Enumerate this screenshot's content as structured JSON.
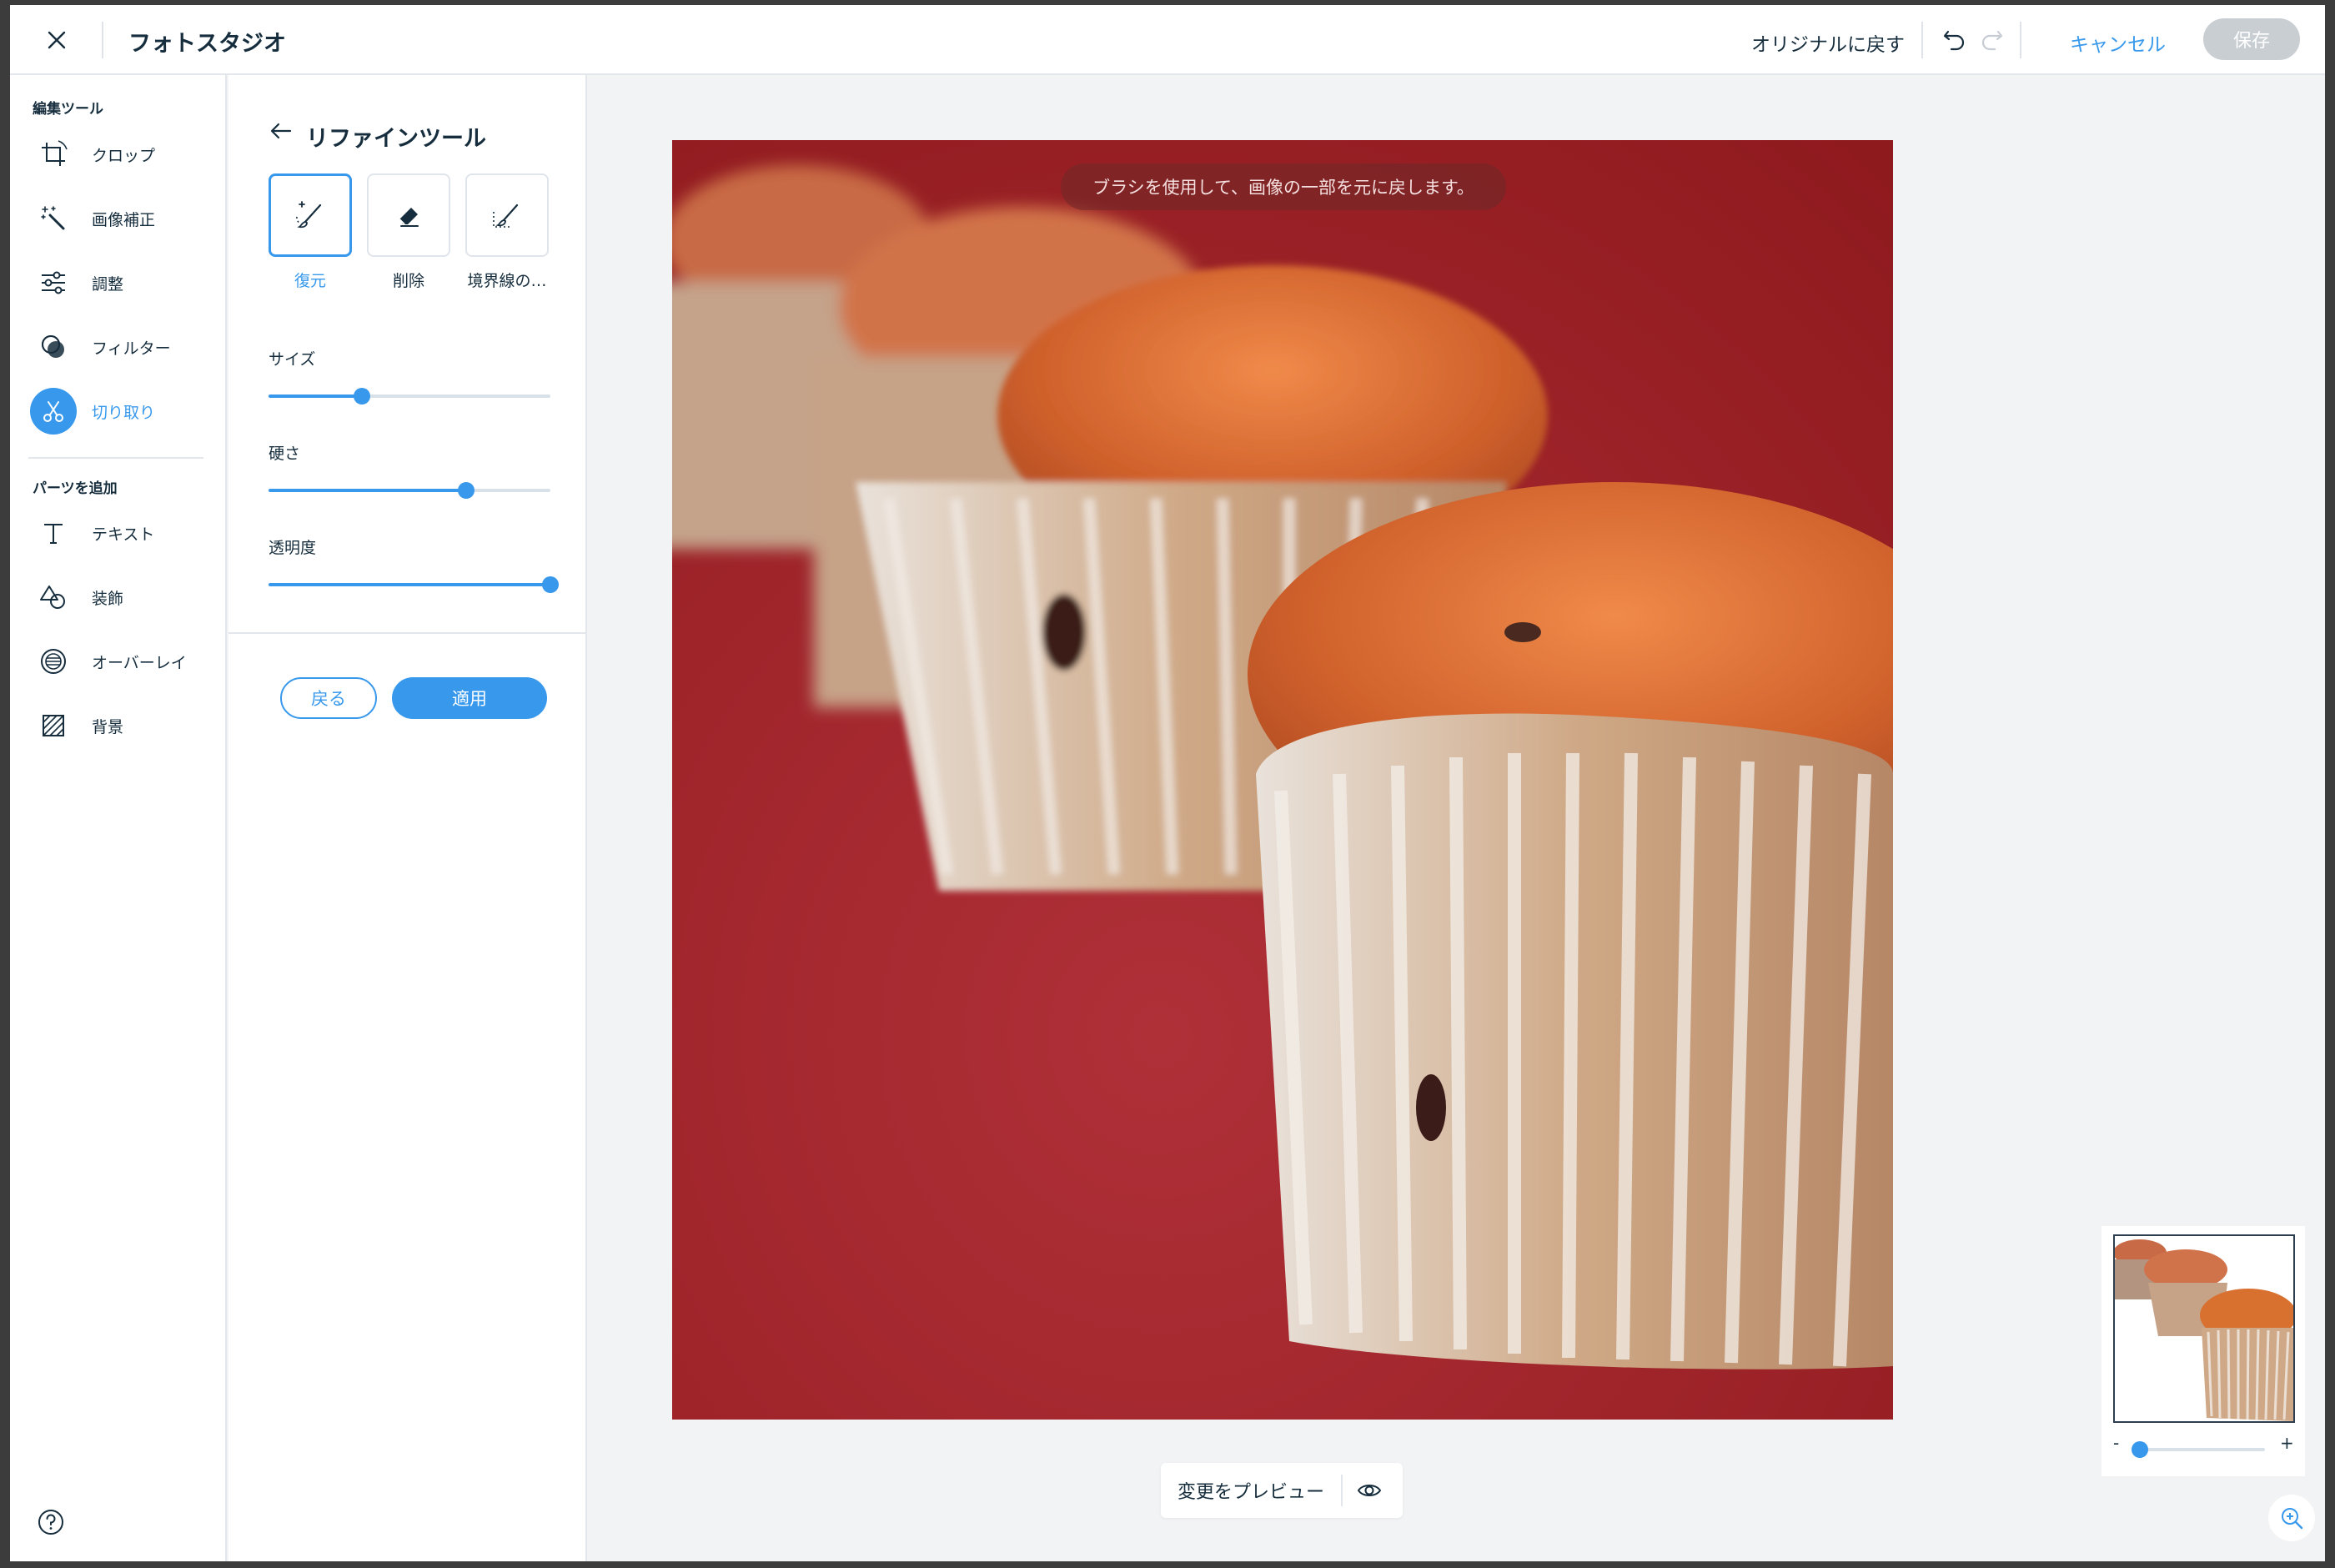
{
  "header": {
    "title": "フォトスタジオ",
    "revert_label": "オリジナルに戻す",
    "cancel_label": "キャンセル",
    "save_label": "保存"
  },
  "sidebar": {
    "edit_section_title": "編集ツール",
    "edit_items": [
      {
        "label": "クロップ",
        "icon": "crop-icon"
      },
      {
        "label": "画像補正",
        "icon": "magic-wand-icon"
      },
      {
        "label": "調整",
        "icon": "sliders-icon"
      },
      {
        "label": "フィルター",
        "icon": "filter-icon"
      },
      {
        "label": "切り取り",
        "icon": "scissors-icon",
        "active": true
      }
    ],
    "add_section_title": "パーツを追加",
    "add_items": [
      {
        "label": "テキスト",
        "icon": "text-icon"
      },
      {
        "label": "装飾",
        "icon": "shapes-icon"
      },
      {
        "label": "オーバーレイ",
        "icon": "overlay-icon"
      },
      {
        "label": "背景",
        "icon": "background-icon"
      }
    ]
  },
  "refine_panel": {
    "title": "リファインツール",
    "tools": [
      {
        "label": "復元",
        "icon": "restore-brush-icon",
        "active": true
      },
      {
        "label": "削除",
        "icon": "eraser-icon"
      },
      {
        "label": "境界線の…",
        "icon": "edge-brush-icon"
      }
    ],
    "sliders": [
      {
        "label": "サイズ",
        "value_percent": 33
      },
      {
        "label": "硬さ",
        "value_percent": 70
      },
      {
        "label": "透明度",
        "value_percent": 100
      }
    ],
    "back_label": "戻る",
    "apply_label": "適用"
  },
  "canvas": {
    "hint": "ブラシを使用して、画像の一部を元に戻します。",
    "preview_label": "変更をプレビュー",
    "zoom_percent": 0,
    "zoom_minus": "-",
    "zoom_plus": "+"
  },
  "colors": {
    "accent": "#3899ec",
    "image_background": "#a3242a",
    "text": "#162d3d"
  }
}
